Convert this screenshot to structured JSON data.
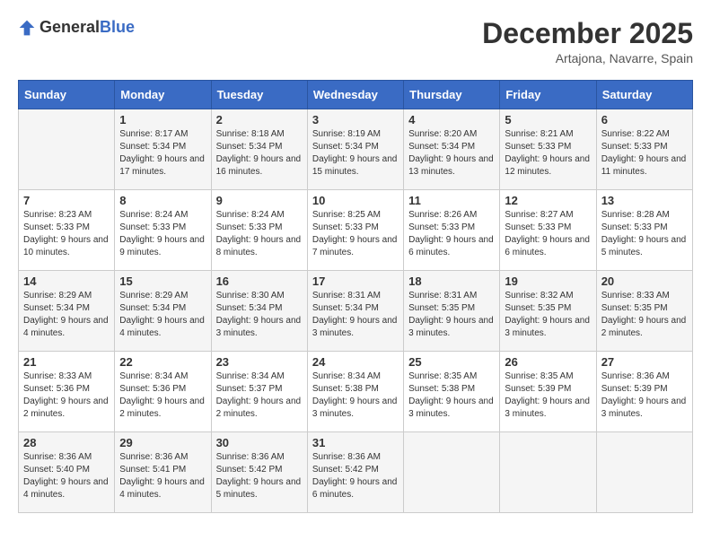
{
  "header": {
    "logo_general": "General",
    "logo_blue": "Blue",
    "month_year": "December 2025",
    "location": "Artajona, Navarre, Spain"
  },
  "weekdays": [
    "Sunday",
    "Monday",
    "Tuesday",
    "Wednesday",
    "Thursday",
    "Friday",
    "Saturday"
  ],
  "weeks": [
    [
      {
        "day": "",
        "info": ""
      },
      {
        "day": "1",
        "info": "Sunrise: 8:17 AM\nSunset: 5:34 PM\nDaylight: 9 hours\nand 17 minutes."
      },
      {
        "day": "2",
        "info": "Sunrise: 8:18 AM\nSunset: 5:34 PM\nDaylight: 9 hours\nand 16 minutes."
      },
      {
        "day": "3",
        "info": "Sunrise: 8:19 AM\nSunset: 5:34 PM\nDaylight: 9 hours\nand 15 minutes."
      },
      {
        "day": "4",
        "info": "Sunrise: 8:20 AM\nSunset: 5:34 PM\nDaylight: 9 hours\nand 13 minutes."
      },
      {
        "day": "5",
        "info": "Sunrise: 8:21 AM\nSunset: 5:33 PM\nDaylight: 9 hours\nand 12 minutes."
      },
      {
        "day": "6",
        "info": "Sunrise: 8:22 AM\nSunset: 5:33 PM\nDaylight: 9 hours\nand 11 minutes."
      }
    ],
    [
      {
        "day": "7",
        "info": "Sunrise: 8:23 AM\nSunset: 5:33 PM\nDaylight: 9 hours\nand 10 minutes."
      },
      {
        "day": "8",
        "info": "Sunrise: 8:24 AM\nSunset: 5:33 PM\nDaylight: 9 hours\nand 9 minutes."
      },
      {
        "day": "9",
        "info": "Sunrise: 8:24 AM\nSunset: 5:33 PM\nDaylight: 9 hours\nand 8 minutes."
      },
      {
        "day": "10",
        "info": "Sunrise: 8:25 AM\nSunset: 5:33 PM\nDaylight: 9 hours\nand 7 minutes."
      },
      {
        "day": "11",
        "info": "Sunrise: 8:26 AM\nSunset: 5:33 PM\nDaylight: 9 hours\nand 6 minutes."
      },
      {
        "day": "12",
        "info": "Sunrise: 8:27 AM\nSunset: 5:33 PM\nDaylight: 9 hours\nand 6 minutes."
      },
      {
        "day": "13",
        "info": "Sunrise: 8:28 AM\nSunset: 5:33 PM\nDaylight: 9 hours\nand 5 minutes."
      }
    ],
    [
      {
        "day": "14",
        "info": "Sunrise: 8:29 AM\nSunset: 5:34 PM\nDaylight: 9 hours\nand 4 minutes."
      },
      {
        "day": "15",
        "info": "Sunrise: 8:29 AM\nSunset: 5:34 PM\nDaylight: 9 hours\nand 4 minutes."
      },
      {
        "day": "16",
        "info": "Sunrise: 8:30 AM\nSunset: 5:34 PM\nDaylight: 9 hours\nand 3 minutes."
      },
      {
        "day": "17",
        "info": "Sunrise: 8:31 AM\nSunset: 5:34 PM\nDaylight: 9 hours\nand 3 minutes."
      },
      {
        "day": "18",
        "info": "Sunrise: 8:31 AM\nSunset: 5:35 PM\nDaylight: 9 hours\nand 3 minutes."
      },
      {
        "day": "19",
        "info": "Sunrise: 8:32 AM\nSunset: 5:35 PM\nDaylight: 9 hours\nand 3 minutes."
      },
      {
        "day": "20",
        "info": "Sunrise: 8:33 AM\nSunset: 5:35 PM\nDaylight: 9 hours\nand 2 minutes."
      }
    ],
    [
      {
        "day": "21",
        "info": "Sunrise: 8:33 AM\nSunset: 5:36 PM\nDaylight: 9 hours\nand 2 minutes."
      },
      {
        "day": "22",
        "info": "Sunrise: 8:34 AM\nSunset: 5:36 PM\nDaylight: 9 hours\nand 2 minutes."
      },
      {
        "day": "23",
        "info": "Sunrise: 8:34 AM\nSunset: 5:37 PM\nDaylight: 9 hours\nand 2 minutes."
      },
      {
        "day": "24",
        "info": "Sunrise: 8:34 AM\nSunset: 5:38 PM\nDaylight: 9 hours\nand 3 minutes."
      },
      {
        "day": "25",
        "info": "Sunrise: 8:35 AM\nSunset: 5:38 PM\nDaylight: 9 hours\nand 3 minutes."
      },
      {
        "day": "26",
        "info": "Sunrise: 8:35 AM\nSunset: 5:39 PM\nDaylight: 9 hours\nand 3 minutes."
      },
      {
        "day": "27",
        "info": "Sunrise: 8:36 AM\nSunset: 5:39 PM\nDaylight: 9 hours\nand 3 minutes."
      }
    ],
    [
      {
        "day": "28",
        "info": "Sunrise: 8:36 AM\nSunset: 5:40 PM\nDaylight: 9 hours\nand 4 minutes."
      },
      {
        "day": "29",
        "info": "Sunrise: 8:36 AM\nSunset: 5:41 PM\nDaylight: 9 hours\nand 4 minutes."
      },
      {
        "day": "30",
        "info": "Sunrise: 8:36 AM\nSunset: 5:42 PM\nDaylight: 9 hours\nand 5 minutes."
      },
      {
        "day": "31",
        "info": "Sunrise: 8:36 AM\nSunset: 5:42 PM\nDaylight: 9 hours\nand 6 minutes."
      },
      {
        "day": "",
        "info": ""
      },
      {
        "day": "",
        "info": ""
      },
      {
        "day": "",
        "info": ""
      }
    ]
  ]
}
